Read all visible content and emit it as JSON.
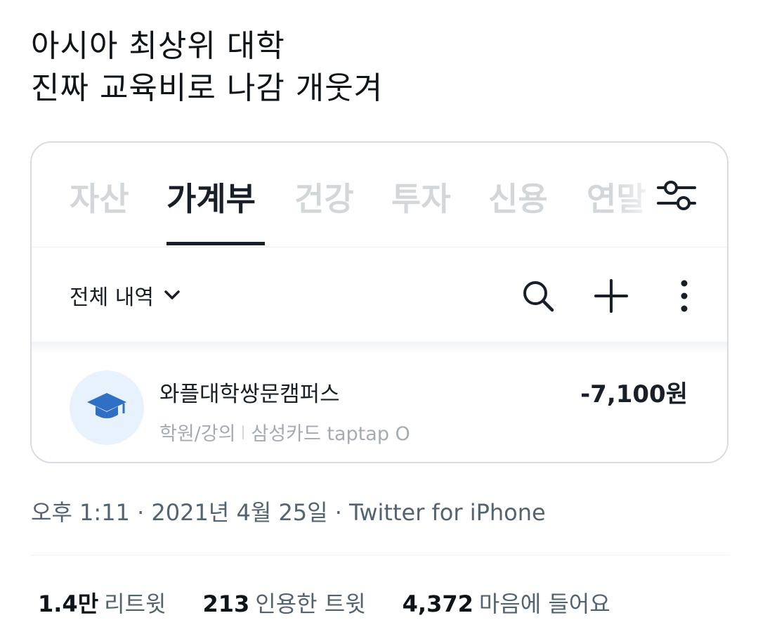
{
  "tweet": {
    "line1": "아시아 최상위 대학",
    "line2": "진짜 교육비로 나감 개웃겨"
  },
  "app": {
    "tabs": [
      {
        "label": "자산",
        "active": false
      },
      {
        "label": "가계부",
        "active": true
      },
      {
        "label": "건강",
        "active": false
      },
      {
        "label": "투자",
        "active": false
      },
      {
        "label": "신용",
        "active": false
      },
      {
        "label": "연말",
        "active": false
      }
    ],
    "filter_label": "전체 내역",
    "transaction": {
      "merchant": "와플대학쌍문캠퍼스",
      "category": "학원/강의",
      "card": "삼성카드 taptap O",
      "amount": "-7,100원",
      "icon": "graduation-cap-icon",
      "icon_color": "#2f6fc4"
    }
  },
  "footer": {
    "timestamp": "오후 1:11 · 2021년 4월 25일 · Twitter for iPhone",
    "stats": [
      {
        "number": "1.4만",
        "label": "리트윗"
      },
      {
        "number": "213",
        "label": "인용한 트윗"
      },
      {
        "number": "4,372",
        "label": "마음에 들어요"
      }
    ]
  }
}
